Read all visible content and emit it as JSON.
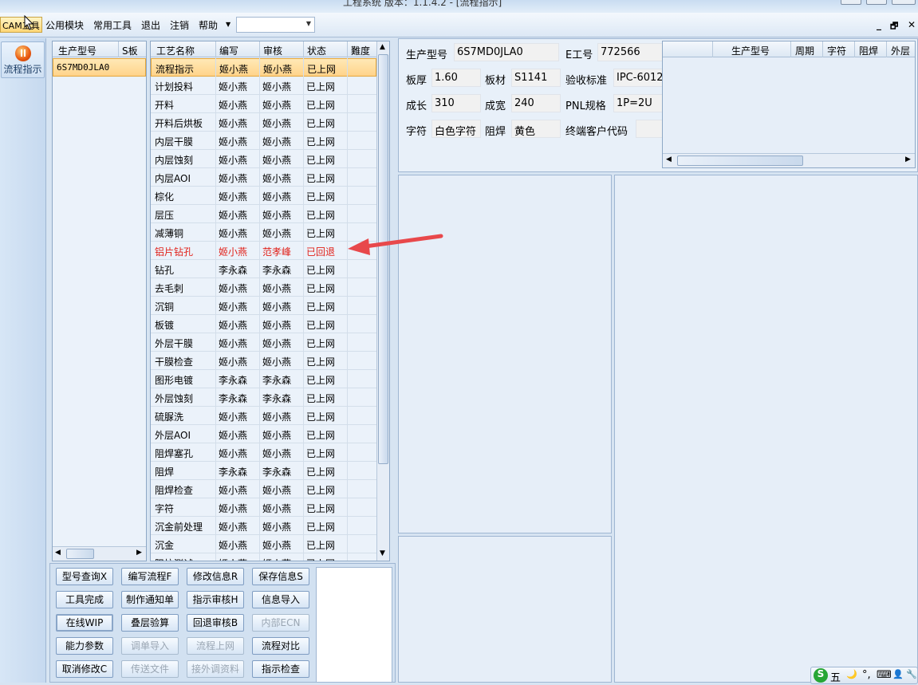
{
  "window": {
    "title": "工程系统   版本：1.1.4.2 - [流程指示]"
  },
  "menubar": {
    "items": [
      "CAM工具",
      "公用模块",
      "常用工具",
      "退出",
      "注销",
      "帮助"
    ],
    "combo_value": "",
    "mdi_minimize": "_",
    "mdi_restore": "🗗",
    "mdi_close": "✕"
  },
  "sidebar": {
    "flow_button_label": "流程指示",
    "flow_icon": "pause-icon"
  },
  "model_list": {
    "headers": [
      "生产型号",
      "S板"
    ],
    "rows": [
      {
        "model": "6S7MD0JLA0",
        "s": ""
      }
    ]
  },
  "process_table": {
    "headers": [
      "工艺名称",
      "编写",
      "审核",
      "状态",
      "難度"
    ],
    "rows": [
      {
        "name": "流程指示",
        "writer": "姬小燕",
        "reviewer": "姬小燕",
        "status": "已上网"
      },
      {
        "name": "计划投料",
        "writer": "姬小燕",
        "reviewer": "姬小燕",
        "status": "已上网"
      },
      {
        "name": "开料",
        "writer": "姬小燕",
        "reviewer": "姬小燕",
        "status": "已上网"
      },
      {
        "name": "开料后烘板",
        "writer": "姬小燕",
        "reviewer": "姬小燕",
        "status": "已上网"
      },
      {
        "name": "内层干膜",
        "writer": "姬小燕",
        "reviewer": "姬小燕",
        "status": "已上网"
      },
      {
        "name": "内层蚀刻",
        "writer": "姬小燕",
        "reviewer": "姬小燕",
        "status": "已上网"
      },
      {
        "name": "内层AOI",
        "writer": "姬小燕",
        "reviewer": "姬小燕",
        "status": "已上网"
      },
      {
        "name": "棕化",
        "writer": "姬小燕",
        "reviewer": "姬小燕",
        "status": "已上网"
      },
      {
        "name": "层压",
        "writer": "姬小燕",
        "reviewer": "姬小燕",
        "status": "已上网"
      },
      {
        "name": "减薄铜",
        "writer": "姬小燕",
        "reviewer": "姬小燕",
        "status": "已上网"
      },
      {
        "name": "铝片钻孔",
        "writer": "姬小燕",
        "reviewer": "范孝峰",
        "status": "已回退"
      },
      {
        "name": "钻孔",
        "writer": "李永森",
        "reviewer": "李永森",
        "status": "已上网"
      },
      {
        "name": "去毛刺",
        "writer": "姬小燕",
        "reviewer": "姬小燕",
        "status": "已上网"
      },
      {
        "name": "沉铜",
        "writer": "姬小燕",
        "reviewer": "姬小燕",
        "status": "已上网"
      },
      {
        "name": "板镀",
        "writer": "姬小燕",
        "reviewer": "姬小燕",
        "status": "已上网"
      },
      {
        "name": "外层干膜",
        "writer": "姬小燕",
        "reviewer": "姬小燕",
        "status": "已上网"
      },
      {
        "name": "干膜检查",
        "writer": "姬小燕",
        "reviewer": "姬小燕",
        "status": "已上网"
      },
      {
        "name": "图形电镀",
        "writer": "李永森",
        "reviewer": "李永森",
        "status": "已上网"
      },
      {
        "name": "外层蚀刻",
        "writer": "李永森",
        "reviewer": "李永森",
        "status": "已上网"
      },
      {
        "name": "硫脲洗",
        "writer": "姬小燕",
        "reviewer": "姬小燕",
        "status": "已上网"
      },
      {
        "name": "外层AOI",
        "writer": "姬小燕",
        "reviewer": "姬小燕",
        "status": "已上网"
      },
      {
        "name": "阻焊塞孔",
        "writer": "姬小燕",
        "reviewer": "姬小燕",
        "status": "已上网"
      },
      {
        "name": "阻焊",
        "writer": "李永森",
        "reviewer": "李永森",
        "status": "已上网"
      },
      {
        "name": "阻焊检查",
        "writer": "姬小燕",
        "reviewer": "姬小燕",
        "status": "已上网"
      },
      {
        "name": "字符",
        "writer": "姬小燕",
        "reviewer": "姬小燕",
        "status": "已上网"
      },
      {
        "name": "沉金前处理",
        "writer": "姬小燕",
        "reviewer": "姬小燕",
        "status": "已上网"
      },
      {
        "name": "沉金",
        "writer": "姬小燕",
        "reviewer": "姬小燕",
        "status": "已上网"
      },
      {
        "name": "阻抗测试",
        "writer": "姬小燕",
        "reviewer": "姬小燕",
        "status": "已上网"
      }
    ]
  },
  "buttons": [
    [
      "型号查询X",
      "编写流程F",
      "修改信息R",
      "保存信息S"
    ],
    [
      "工具完成",
      "制作通知单",
      "指示审核H",
      "信息导入"
    ],
    [
      "在线WIP",
      "叠层验算",
      "回退审核B",
      "内部ECN"
    ],
    [
      "能力参数",
      "调单导入",
      "流程上网",
      "流程对比"
    ],
    [
      "取消修改C",
      "传送文件",
      "接外调资料",
      "指示检查"
    ]
  ],
  "disabled_buttons": [
    "内部ECN",
    "调单导入",
    "流程上网",
    "传送文件",
    "接外调资料"
  ],
  "info": {
    "model_label": "生产型号",
    "model_value": "6S7MD0JLA0",
    "eng_label": "E工号",
    "eng_value": "772566",
    "thickness_label": "板厚",
    "thickness_value": "1.60",
    "material_label": "板材",
    "material_value": "S1141",
    "standard_label": "验收标准",
    "standard_value": "IPC-6012",
    "length_label": "成长",
    "length_value": "310",
    "width_label": "成宽",
    "width_value": "240",
    "pnl_label": "PNL规格",
    "pnl_value": "1P=2U",
    "char_label": "字符",
    "char_value": "白色字符",
    "solder_label": "阻焊",
    "solder_value": "黄色",
    "customer_label": "终端客户代码",
    "customer_value": ""
  },
  "sub_table": {
    "headers": [
      "生产型号",
      "周期",
      "字符",
      "阻焊",
      "外层"
    ]
  },
  "tray": {
    "ime": "五",
    "items": [
      "🌙",
      "°,",
      "⌨",
      "👤",
      "🔧"
    ]
  },
  "colors": {
    "accent_red": "#e1211a",
    "selection": "#ffd38a",
    "arrow": "#e8484b"
  }
}
